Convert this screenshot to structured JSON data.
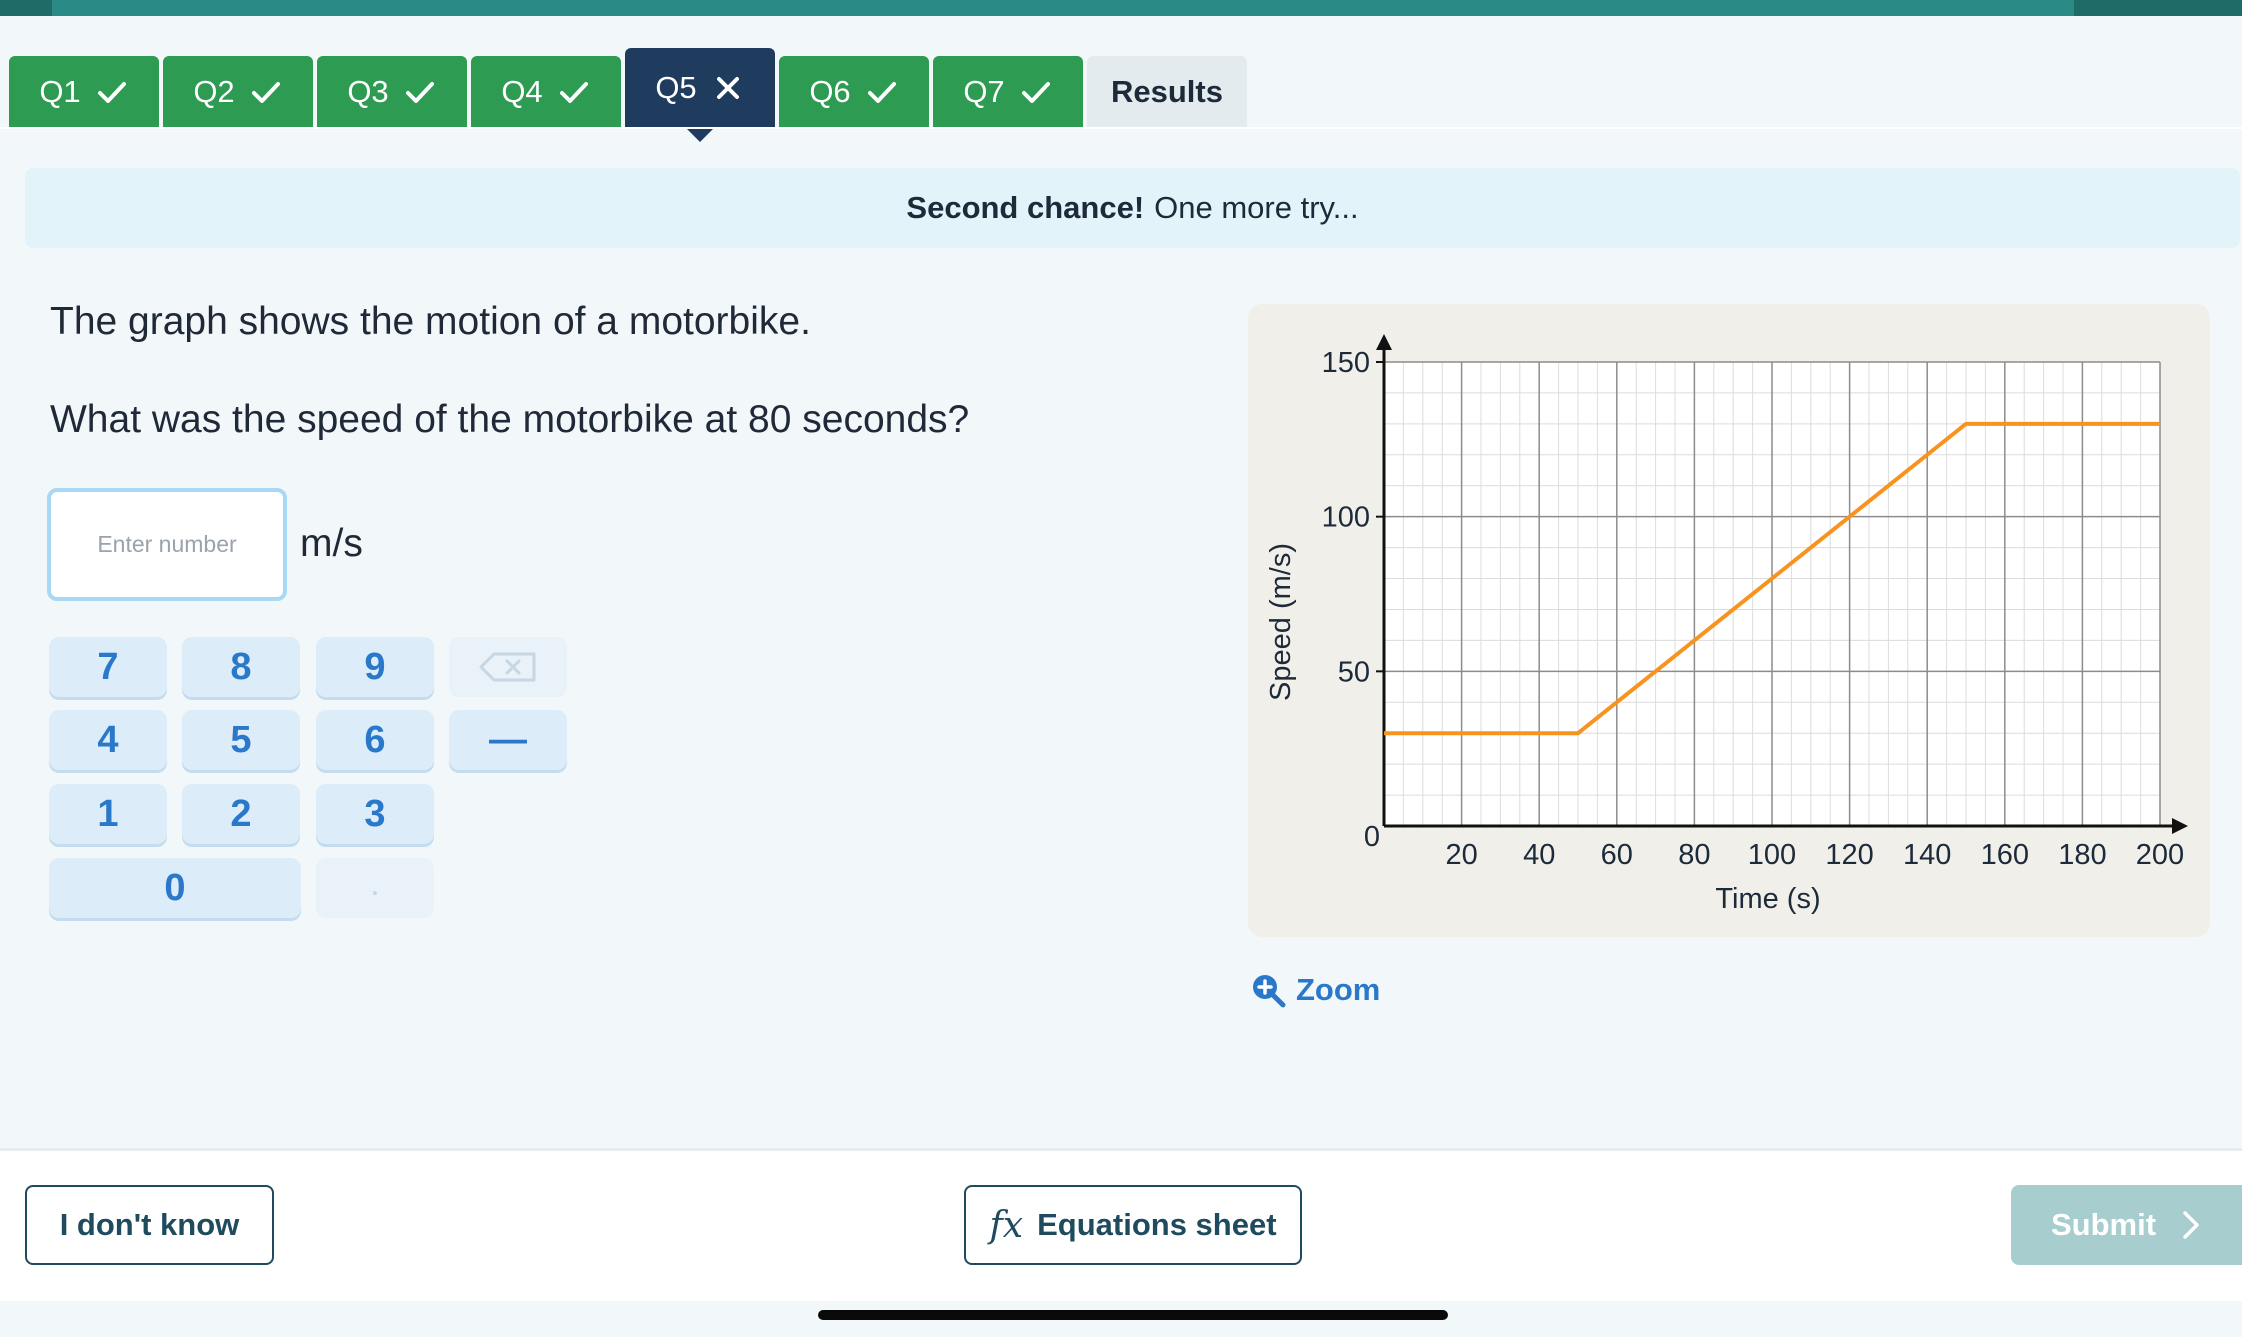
{
  "tabs": [
    {
      "label": "Q1",
      "status": "correct",
      "icon": "check-icon"
    },
    {
      "label": "Q2",
      "status": "correct",
      "icon": "check-icon"
    },
    {
      "label": "Q3",
      "status": "correct",
      "icon": "check-icon"
    },
    {
      "label": "Q4",
      "status": "correct",
      "icon": "check-icon"
    },
    {
      "label": "Q5",
      "status": "incorrect",
      "icon": "cross-icon",
      "current": true
    },
    {
      "label": "Q6",
      "status": "correct",
      "icon": "check-icon"
    },
    {
      "label": "Q7",
      "status": "correct",
      "icon": "check-icon"
    },
    {
      "label": "Results"
    }
  ],
  "banner": {
    "strong": "Second chance!",
    "text": "One more try..."
  },
  "question": {
    "line1": "The graph shows the motion of a motorbike.",
    "line2": "What was the speed of the motorbike at 80 seconds?"
  },
  "answer": {
    "placeholder": "Enter number",
    "value": "",
    "unit": "m/s"
  },
  "keypad": {
    "keys": [
      "7",
      "8",
      "9",
      "4",
      "5",
      "6",
      "1",
      "2",
      "3",
      "0",
      "."
    ],
    "minus_label": "—",
    "backspace_icon": "backspace-icon"
  },
  "zoom": {
    "label": "Zoom",
    "icon": "zoom-in-icon"
  },
  "footer": {
    "dont_know": "I don't know",
    "equations_fx": "fx",
    "equations": "Equations sheet",
    "submit": "Submit"
  },
  "colors": {
    "correct_tab": "#2d9b52",
    "current_tab": "#1f3b5e",
    "accent_blue": "#2a78c9",
    "line": "#f7931e"
  },
  "chart_data": {
    "type": "line",
    "xlabel": "Time (s)",
    "ylabel": "Speed (m/s)",
    "xlim": [
      0,
      200
    ],
    "ylim": [
      0,
      150
    ],
    "xticks": [
      20,
      40,
      60,
      80,
      100,
      120,
      140,
      160,
      180,
      200
    ],
    "yticks": [
      0,
      50,
      100,
      150
    ],
    "x_origin_label": "0",
    "grid": true,
    "series": [
      {
        "x": [
          0,
          50,
          150,
          200
        ],
        "y": [
          30,
          30,
          130,
          130
        ]
      }
    ]
  }
}
